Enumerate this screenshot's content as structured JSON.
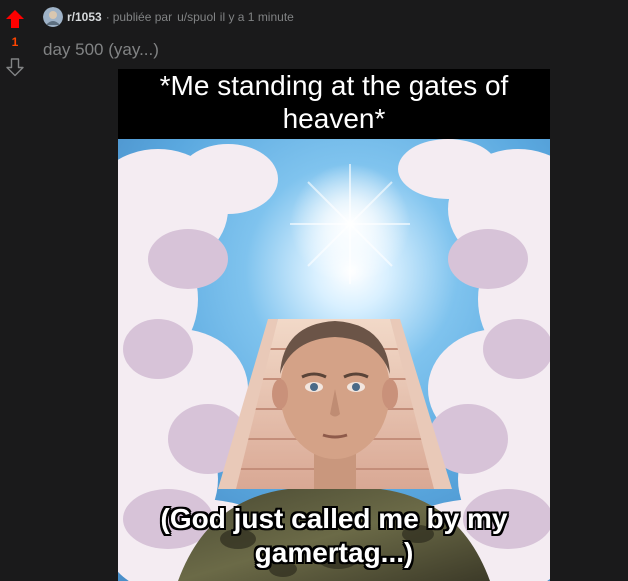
{
  "vote": {
    "score": "1",
    "upvote_color": "#ff0000",
    "downvote_color": "#818384",
    "upvote_icon": "arrow-up-icon",
    "downvote_icon": "arrow-down-icon"
  },
  "header": {
    "subreddit": "r/1053",
    "separator": "·",
    "posted_by": "publiée par",
    "author": "u/spuol",
    "time": "il y a 1 minute"
  },
  "post": {
    "title": "day 500 (yay...)"
  },
  "meme": {
    "top_text": "*Me standing at the gates of heaven*",
    "bottom_text": "(God just called me by my gamertag...)"
  },
  "colors": {
    "background": "#1a1a1b",
    "muted_text": "#818384",
    "accent": "#ff4500"
  }
}
